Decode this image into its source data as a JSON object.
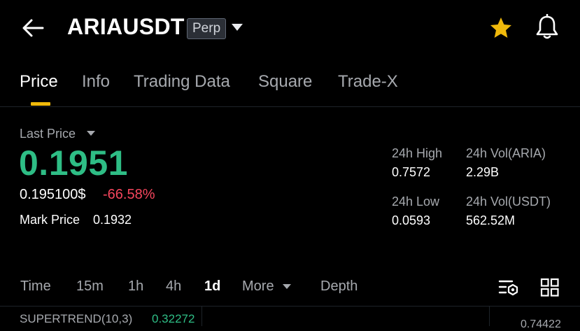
{
  "header": {
    "symbol": "ARIAUSDT",
    "badge": "Perp",
    "icons": [
      "back-arrow-icon",
      "caret-down-icon",
      "star-icon",
      "bell-icon"
    ]
  },
  "tabs": [
    {
      "label": "Price",
      "active": true
    },
    {
      "label": "Info",
      "active": false
    },
    {
      "label": "Trading Data",
      "active": false
    },
    {
      "label": "Square",
      "active": false
    },
    {
      "label": "Trade-X",
      "active": false
    }
  ],
  "price": {
    "last_label": "Last Price",
    "last_price": "0.1951",
    "usd_price": "0.195100$",
    "change_pct": "-66.58%",
    "mark_label": "Mark Price",
    "mark_price": "0.1932"
  },
  "stats": {
    "high_label": "24h High",
    "high_value": "0.7572",
    "vol_base_label": "24h Vol(ARIA)",
    "vol_base_value": "2.29B",
    "low_label": "24h Low",
    "low_value": "0.0593",
    "vol_quote_label": "24h Vol(USDT)",
    "vol_quote_value": "562.52M"
  },
  "intervals": {
    "time": "Time",
    "m15": "15m",
    "h1": "1h",
    "h4": "4h",
    "d1": "1d",
    "more": "More",
    "depth": "Depth",
    "selected": "1d"
  },
  "chart": {
    "indicator_label": "SUPERTREND(10,3)",
    "indicator_value": "0.32272",
    "axis_value": "0.74422"
  },
  "colors": {
    "background": "#000000",
    "up": "#2ebd85",
    "down": "#f6465d",
    "accent": "#f0b90b",
    "muted": "#a6a9ae"
  }
}
